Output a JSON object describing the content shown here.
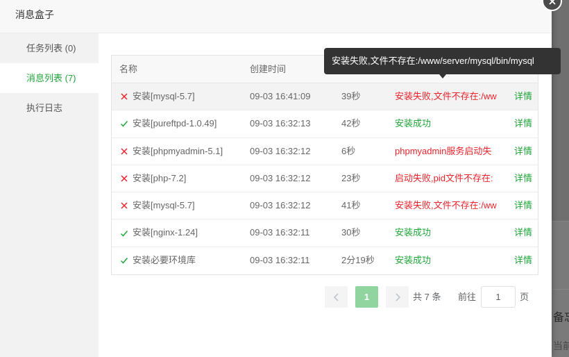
{
  "dialog": {
    "title": "消息盒子",
    "close_icon": "close-icon"
  },
  "sidebar": {
    "items": [
      {
        "label": "任务列表 (0)",
        "active": false
      },
      {
        "label": "消息列表 (7)",
        "active": true
      },
      {
        "label": "执行日志",
        "active": false
      }
    ]
  },
  "table": {
    "columns": [
      "名称",
      "创建时间"
    ],
    "rows": [
      {
        "icon": "cross-icon",
        "name": "安装[mysql-5.7]",
        "time": "09-03 16:41:09",
        "duration": "39秒",
        "message": "安装失败,文件不存在:/ww",
        "message_color": "#e8232b",
        "action": "详情",
        "hovered": true
      },
      {
        "icon": "check-icon",
        "name": "安装[pureftpd-1.0.49]",
        "time": "09-03 16:32:13",
        "duration": "42秒",
        "message": "安装成功",
        "message_color": "#20a53a",
        "action": "详情",
        "hovered": false
      },
      {
        "icon": "cross-icon",
        "name": "安装[phpmyadmin-5.1]",
        "time": "09-03 16:32:12",
        "duration": "6秒",
        "message": "phpmyadmin服务启动失",
        "message_color": "#e8232b",
        "action": "详情",
        "hovered": false
      },
      {
        "icon": "cross-icon",
        "name": "安装[php-7.2]",
        "time": "09-03 16:32:12",
        "duration": "23秒",
        "message": "启动失败,pid文件不存在:",
        "message_color": "#e8232b",
        "action": "详情",
        "hovered": false
      },
      {
        "icon": "cross-icon",
        "name": "安装[mysql-5.7]",
        "time": "09-03 16:32:12",
        "duration": "41秒",
        "message": "安装失败,文件不存在:/ww",
        "message_color": "#e8232b",
        "action": "详情",
        "hovered": false
      },
      {
        "icon": "check-icon",
        "name": "安装[nginx-1.24]",
        "time": "09-03 16:32:11",
        "duration": "30秒",
        "message": "安装成功",
        "message_color": "#20a53a",
        "action": "详情",
        "hovered": false
      },
      {
        "icon": "check-icon",
        "name": "安装必要环境库",
        "time": "09-03 16:32:11",
        "duration": "2分19秒",
        "message": "安装成功",
        "message_color": "#20a53a",
        "action": "详情",
        "hovered": false
      }
    ]
  },
  "tooltip": {
    "text": "安装失败,文件不存在:/www/server/mysql/bin/mysql"
  },
  "pagination": {
    "prev_icon": "chevron-left-icon",
    "current_page": "1",
    "next_icon": "chevron-right-icon",
    "total_text": "共 7 条",
    "goto_label": "前往",
    "goto_value": "1",
    "page_unit": "页"
  },
  "background_page": {
    "texts": [
      "备忘",
      "当前"
    ]
  },
  "colors": {
    "accent": "#20a53a",
    "error": "#e8232b",
    "page_button": "#90d4a0"
  }
}
